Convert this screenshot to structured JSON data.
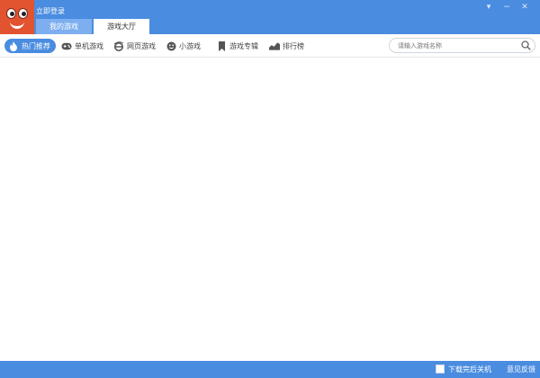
{
  "header": {
    "login_label": "立即登录",
    "tabs": [
      {
        "label": "我的游戏",
        "state": "inactive"
      },
      {
        "label": "游戏大厅",
        "state": "active"
      }
    ],
    "window_controls": {
      "dropdown": "▾",
      "minimize": "−",
      "close": "✕"
    },
    "brand_color": "#4a8ce0"
  },
  "toolbar": {
    "items": [
      {
        "label": "热门推荐",
        "icon": "flame-icon",
        "active": true
      },
      {
        "label": "单机游戏",
        "icon": "gamepad-icon",
        "active": false
      },
      {
        "label": "网页游戏",
        "icon": "browser-e-icon",
        "active": false
      },
      {
        "label": "小游戏",
        "icon": "smiley-icon",
        "active": false
      },
      {
        "label": "游戏专辑",
        "icon": "bookmark-icon",
        "active": false
      },
      {
        "label": "排行榜",
        "icon": "trend-chart-icon",
        "active": false
      }
    ],
    "search": {
      "placeholder": "请输入游戏名称",
      "value": ""
    }
  },
  "footer": {
    "shutdown_label": "下载完后关机",
    "shutdown_checked": false,
    "feedback_label": "意见反馈"
  }
}
